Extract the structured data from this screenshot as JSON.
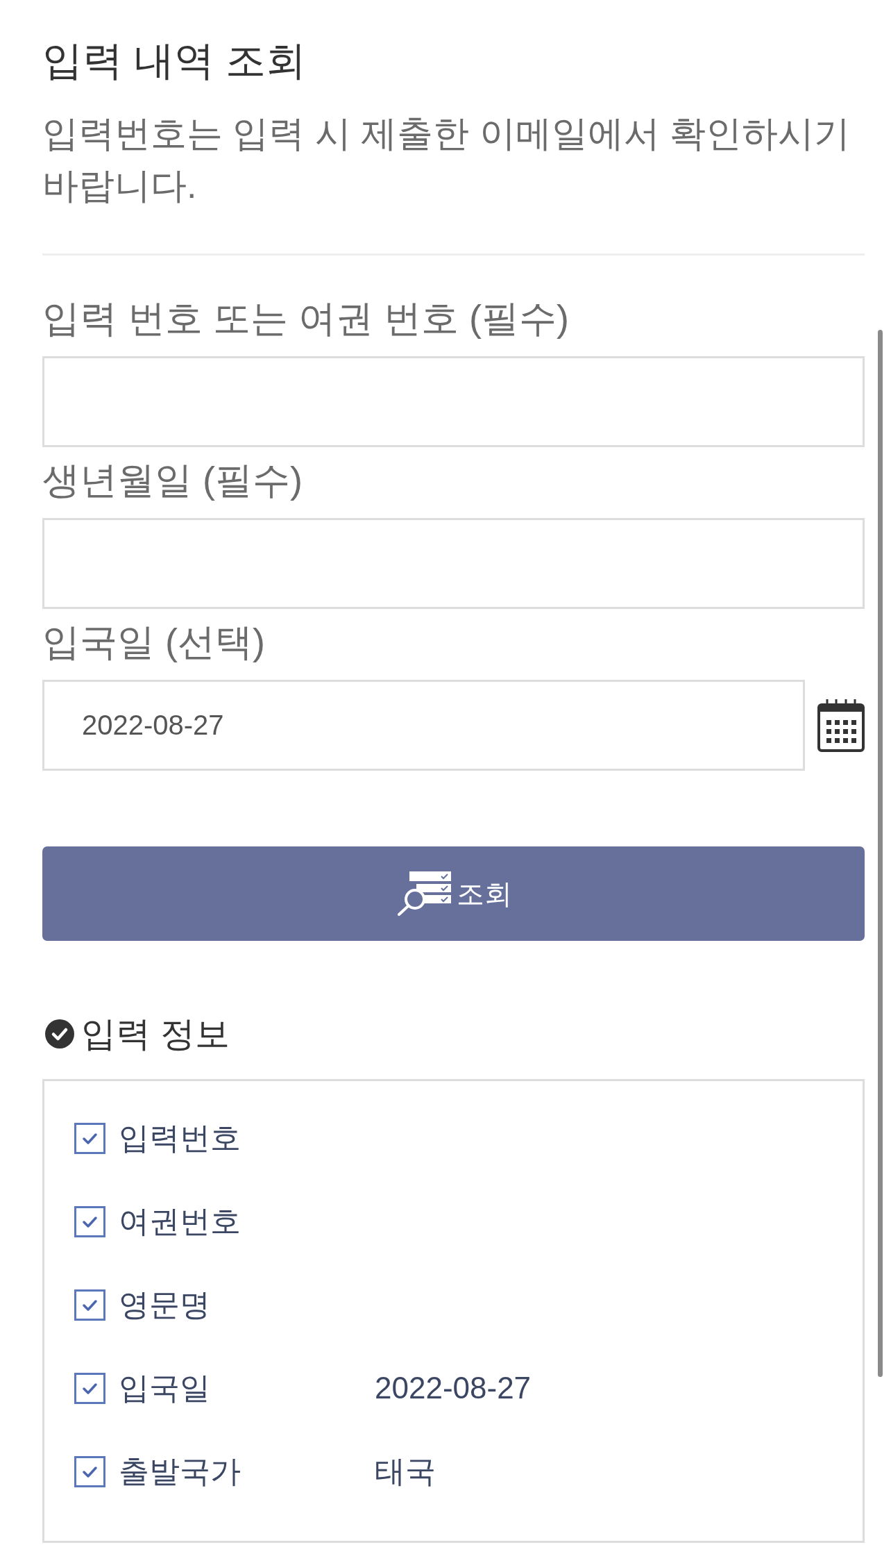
{
  "header": {
    "title": "입력 내역 조회",
    "description": "입력번호는 입력 시 제출한 이메일에서 확인하시기 바랍니다."
  },
  "form": {
    "fields": [
      {
        "kind": "text",
        "label": "입력 번호 또는 여권 번호 (필수)"
      },
      {
        "kind": "text",
        "label": "생년월일 (필수)"
      },
      {
        "kind": "date",
        "label": "입국일 (선택)",
        "value": "2022-08-27"
      }
    ],
    "submit": {
      "label": "조회"
    }
  },
  "entry_info": {
    "title": "입력 정보",
    "items": [
      {
        "label": "입력번호",
        "checked": true
      },
      {
        "label": "여권번호",
        "checked": true
      },
      {
        "label": "영문명",
        "checked": true
      },
      {
        "label": "입국일",
        "value": "2022-08-27",
        "checked": true
      },
      {
        "label": "출발국가",
        "value": "태국",
        "checked": true
      }
    ]
  }
}
